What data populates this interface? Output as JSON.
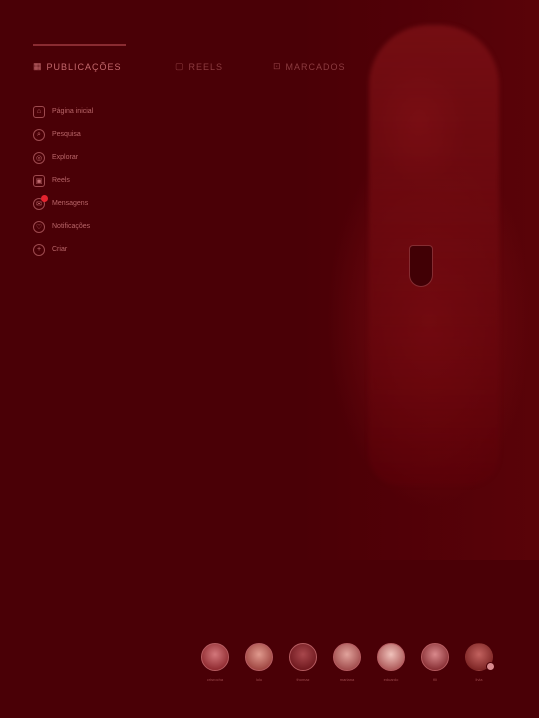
{
  "tabs": [
    {
      "label": "PUBLICAÇÕES",
      "icon": "grid-icon",
      "active": true
    },
    {
      "label": "REELS",
      "icon": "reels-icon",
      "active": false
    },
    {
      "label": "MARCADOS",
      "icon": "tag-icon",
      "active": false
    }
  ],
  "menu": [
    {
      "label": "Página inicial",
      "icon": "home-icon",
      "glyph": "⌂"
    },
    {
      "label": "Pesquisa",
      "icon": "search-icon",
      "glyph": "⌕"
    },
    {
      "label": "Explorar",
      "icon": "compass-icon",
      "glyph": "◎"
    },
    {
      "label": "Reels",
      "icon": "reels-icon",
      "glyph": "▣"
    },
    {
      "label": "Mensagens",
      "icon": "message-icon",
      "glyph": "✉",
      "badge": true
    },
    {
      "label": "Notificações",
      "icon": "heart-icon",
      "glyph": "♡"
    },
    {
      "label": "Criar",
      "icon": "plus-icon",
      "glyph": "+"
    }
  ],
  "stories": [
    {
      "name": "crisrocha"
    },
    {
      "name": "lulu"
    },
    {
      "name": "thomaz"
    },
    {
      "name": "mariana"
    },
    {
      "name": "eduardo"
    },
    {
      "name": "fili"
    },
    {
      "name": "livia",
      "plus": true
    }
  ],
  "colors": {
    "background": "#4a0006",
    "accent": "#e5232f"
  }
}
